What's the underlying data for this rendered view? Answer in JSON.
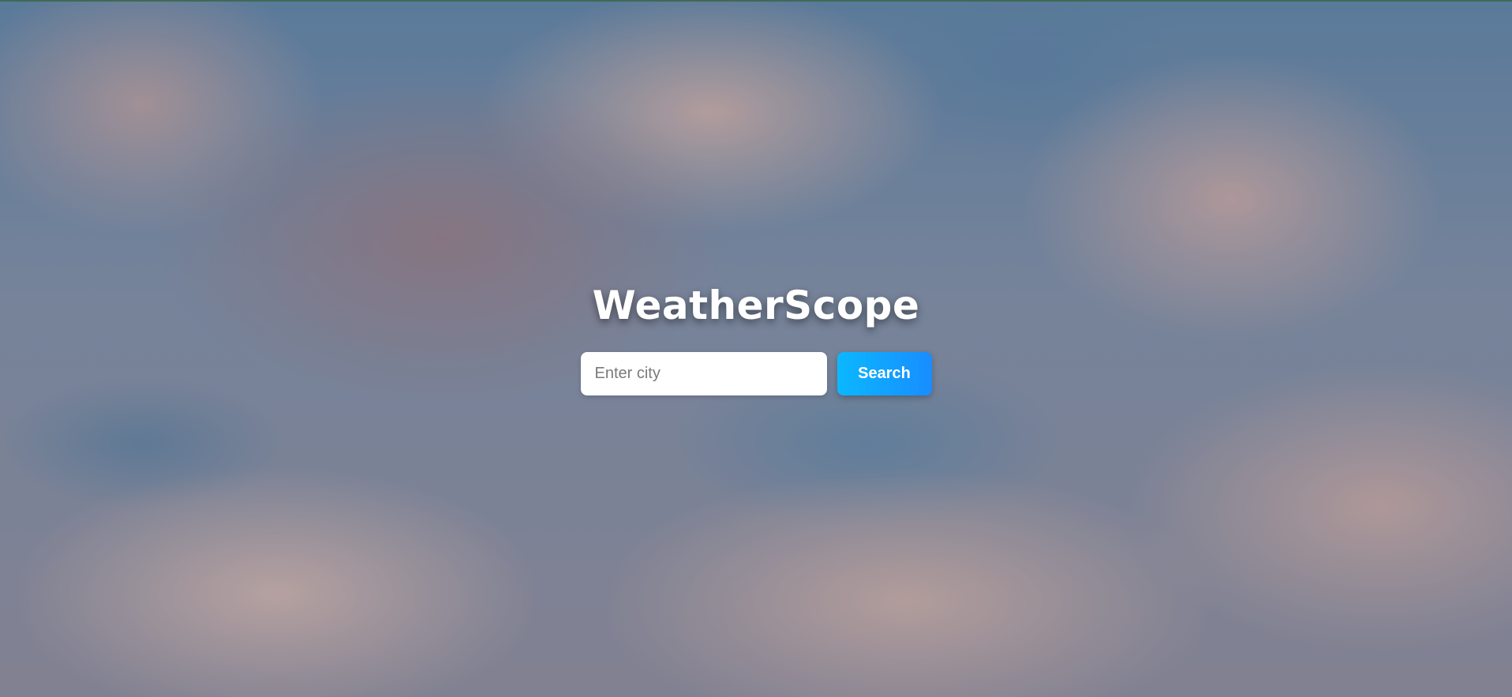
{
  "app": {
    "title": "WeatherScope"
  },
  "search": {
    "placeholder": "Enter city",
    "button_label": "Search"
  },
  "colors": {
    "button_start": "#0bb8ff",
    "button_end": "#188dff",
    "title_text": "#ffffff"
  }
}
